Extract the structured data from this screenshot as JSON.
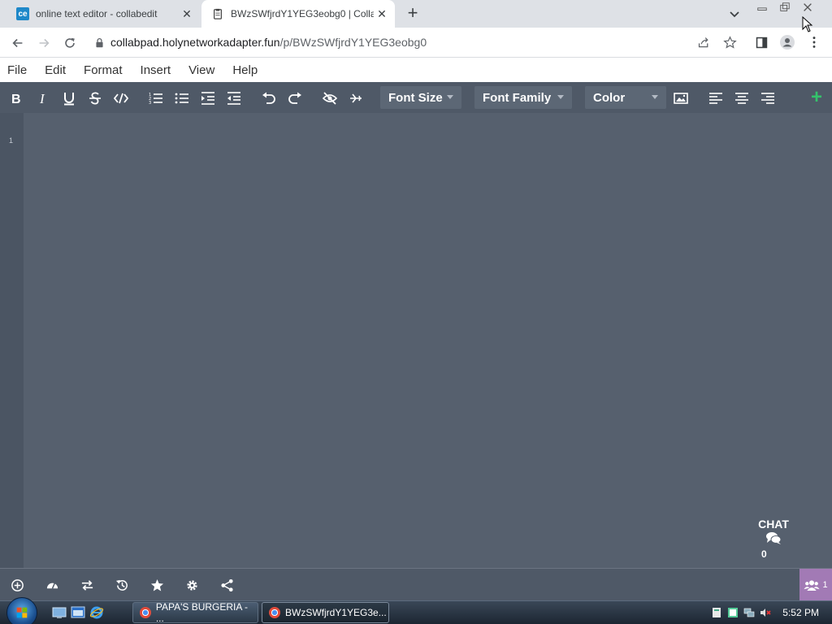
{
  "browser": {
    "tabs": [
      {
        "title": "online text editor - collabedit",
        "favicon": "ce",
        "active": false
      },
      {
        "title": "BWzSWfjrdY1YEG3eobg0 | Collabpad",
        "active": true
      }
    ],
    "url_host": "collabpad.holynetworkadapter.fun",
    "url_path": "/p/BWzSWfjrdY1YEG3eobg0"
  },
  "menu": [
    "File",
    "Edit",
    "Format",
    "Insert",
    "View",
    "Help"
  ],
  "toolbar": {
    "font_size_label": "Font Size",
    "font_family_label": "Font Family",
    "color_label": "Color"
  },
  "editor": {
    "line_number": "1"
  },
  "chat": {
    "label": "CHAT",
    "count": "0"
  },
  "users": {
    "count": "1"
  },
  "taskbar": {
    "windows": [
      {
        "label": "PAPA'S BURGERIA - ...",
        "active": false
      },
      {
        "label": "BWzSWfjrdY1YEG3e...",
        "active": true
      }
    ],
    "time": "5:52 PM"
  },
  "colors": {
    "editor_bg": "#56606e",
    "toolbar_bg": "#4f5967",
    "accent_plus": "#34c26b",
    "users_badge": "#a27ab5"
  }
}
